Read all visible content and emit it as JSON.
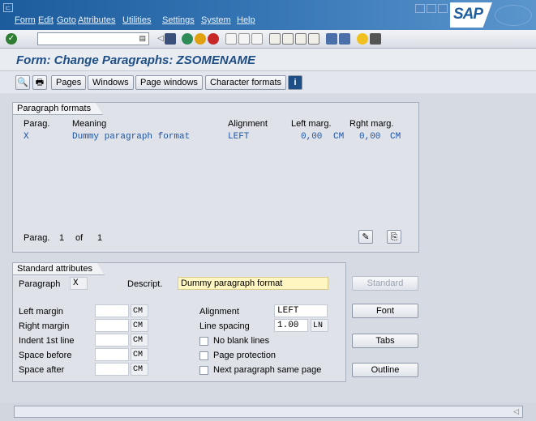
{
  "menu": [
    "Form",
    "Edit",
    "Goto",
    "Attributes",
    "Utilities",
    "Settings",
    "System",
    "Help"
  ],
  "logo_text": "SAP",
  "title": "Form: Change Paragraphs: ZSOMENAME",
  "app_buttons": [
    "Pages",
    "Windows",
    "Page windows",
    "Character formats"
  ],
  "paragraph_formats": {
    "tab": "Paragraph formats",
    "headers": [
      "Parag.",
      "Meaning",
      "Alignment",
      "Left marg.",
      "Rght marg."
    ],
    "rows": [
      {
        "parag": "X",
        "meaning": "Dummy paragraph format",
        "alignment": "LEFT",
        "left": "0,00",
        "left_unit": "CM",
        "right": "0,00",
        "right_unit": "CM"
      }
    ],
    "footer_label": "Parag.",
    "footer_num": "1",
    "footer_of": "of",
    "footer_total": "1"
  },
  "standard_attributes": {
    "tab": "Standard attributes",
    "paragraph_label": "Paragraph",
    "paragraph_value": "X",
    "descript_label": "Descript.",
    "descript_value": "Dummy paragraph format",
    "left_margin_label": "Left margin",
    "left_margin_unit": "CM",
    "right_margin_label": "Right margin",
    "right_margin_unit": "CM",
    "indent_label": "Indent 1st line",
    "indent_unit": "CM",
    "space_before_label": "Space before",
    "space_before_unit": "CM",
    "space_after_label": "Space after",
    "space_after_unit": "CM",
    "alignment_label": "Alignment",
    "alignment_value": "LEFT",
    "line_spacing_label": "Line spacing",
    "line_spacing_value": "1.00",
    "line_spacing_unit": "LN",
    "no_blank_lines": "No blank lines",
    "page_protection": "Page protection",
    "next_paragraph": "Next paragraph same page"
  },
  "side_buttons": {
    "standard": "Standard",
    "font": "Font",
    "tabs": "Tabs",
    "outline": "Outline"
  },
  "colors": {
    "menubar": "#2f6fae",
    "title": "#1d4e86",
    "highlight_field": "#fff6c2",
    "row_text": "#1e55a8"
  }
}
